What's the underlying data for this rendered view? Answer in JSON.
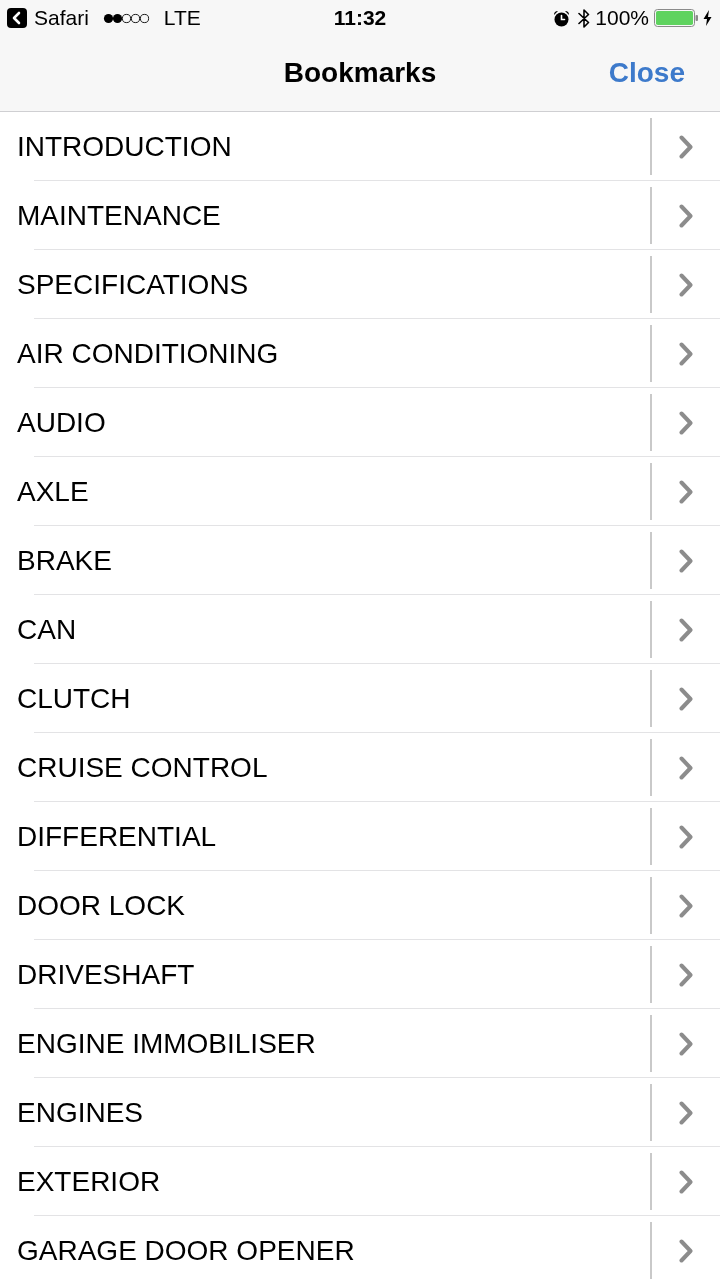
{
  "status_bar": {
    "back_label": "Safari",
    "carrier": "LTE",
    "time": "11:32",
    "battery": "100%"
  },
  "nav_bar": {
    "title": "Bookmarks",
    "close": "Close"
  },
  "bookmarks": [
    "INTRODUCTION",
    "MAINTENANCE",
    "SPECIFICATIONS",
    "AIR CONDITIONING",
    "AUDIO",
    "AXLE",
    "BRAKE",
    "CAN",
    "CLUTCH",
    "CRUISE CONTROL",
    "DIFFERENTIAL",
    "DOOR LOCK",
    "DRIVESHAFT",
    "ENGINE IMMOBILISER",
    "ENGINES",
    "EXTERIOR",
    "GARAGE DOOR OPENER"
  ]
}
